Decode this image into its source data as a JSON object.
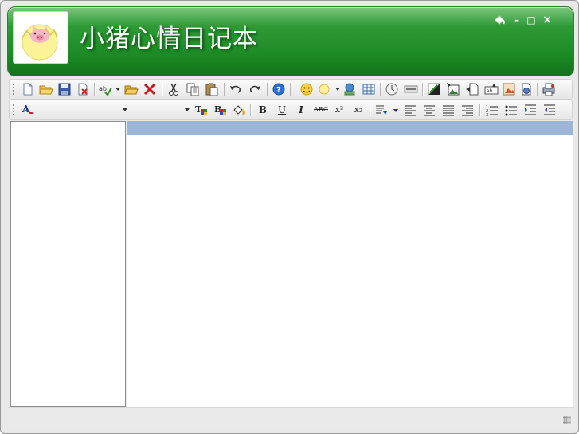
{
  "app": {
    "title": "小猪心情日记本",
    "theme_color": "#1f8a27",
    "window_controls": {
      "paint_icon": "paint-bucket-icon",
      "minimize": "–",
      "maximize": "□",
      "close": "×"
    }
  },
  "toolbar1": {
    "icons": [
      "new-document-icon",
      "open-folder-icon",
      "save-icon",
      "delete-document-icon",
      "spellcheck-icon",
      "open-file-icon",
      "delete-icon",
      "cut-icon",
      "copy-icon",
      "paste-icon",
      "undo-icon",
      "redo-icon",
      "help-icon",
      "emoticon-icon",
      "circle-icon",
      "web-globe-icon",
      "table-icon",
      "clock-icon",
      "horizontal-rule-icon",
      "color-swatch-icon",
      "insert-image-icon",
      "insert-file-icon",
      "insert-object-icon",
      "insert-picture-icon",
      "insert-media-icon",
      "print-icon"
    ]
  },
  "toolbar2": {
    "font_color_label": "A",
    "font_name": "",
    "font_size": "",
    "format_buttons": {
      "bold": "B",
      "underline": "U",
      "italic": "I",
      "strikethrough": "ABC",
      "superscript": "x²",
      "subscript": "x₂"
    },
    "icons": [
      "text-format-icon",
      "background-color-icon",
      "highlight-icon",
      "paragraph-icon",
      "align-left-icon",
      "align-center-icon",
      "align-justify-icon",
      "align-right-icon",
      "numbered-list-icon",
      "bullet-list-icon",
      "indent-icon",
      "outdent-icon"
    ]
  },
  "status": {
    "text": ""
  }
}
